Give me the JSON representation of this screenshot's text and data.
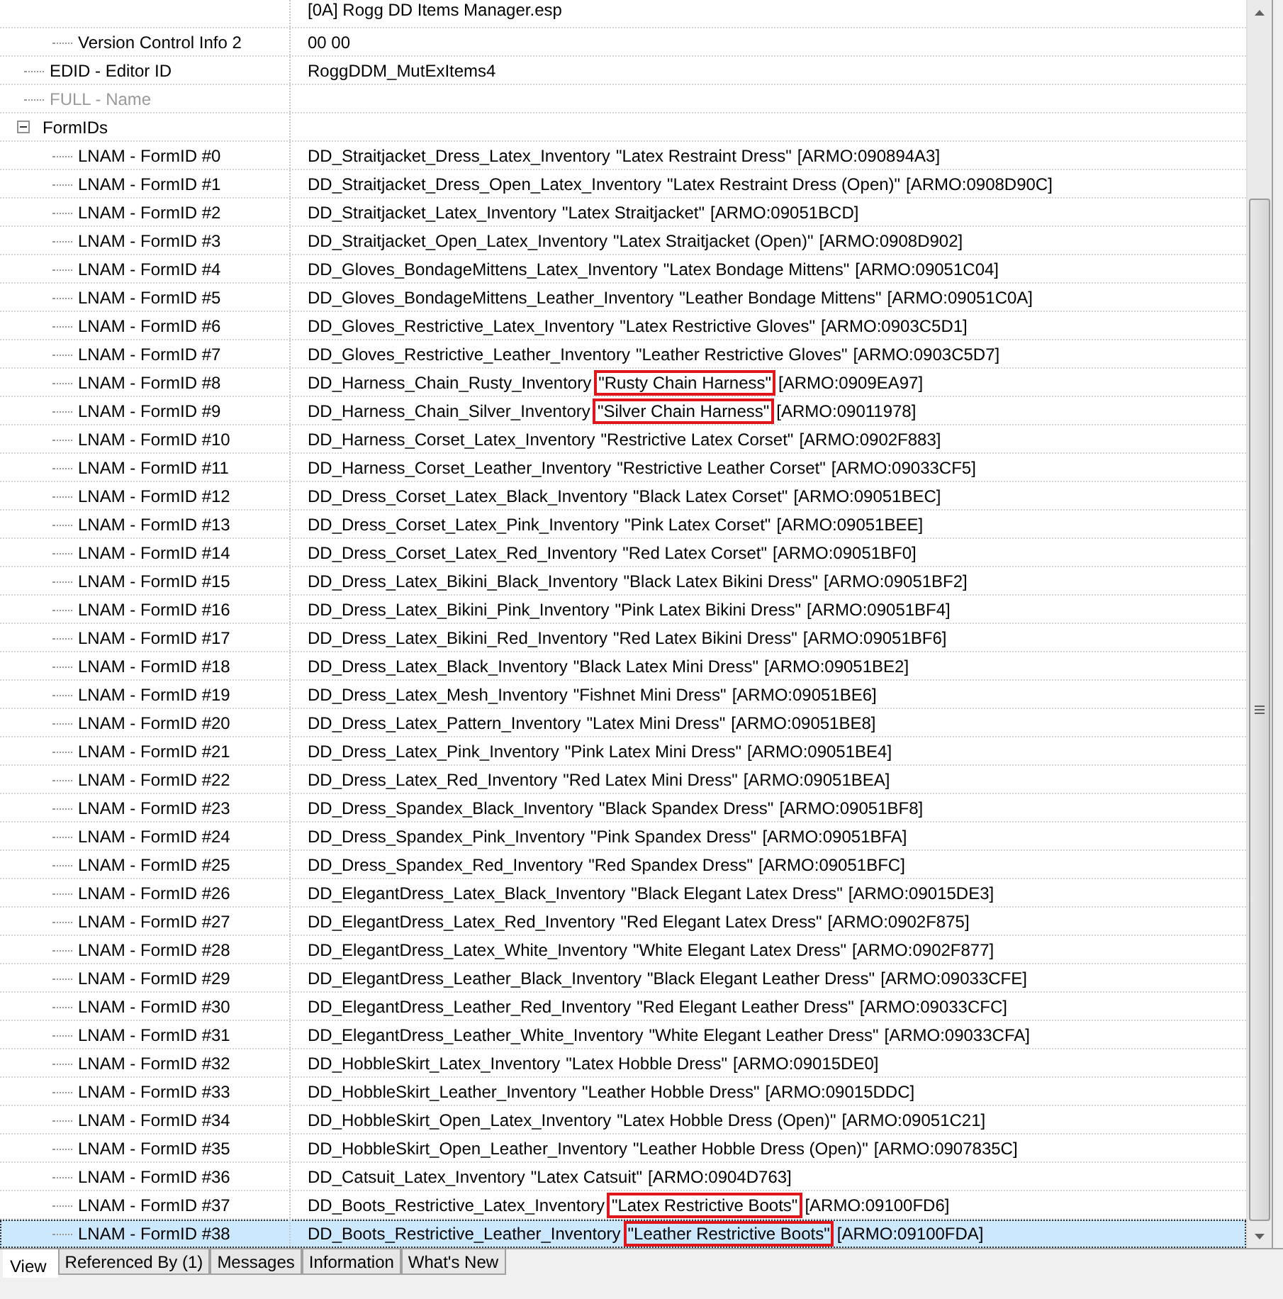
{
  "header": {
    "file": "[0A] Rogg DD Items Manager.esp"
  },
  "tree": [
    {
      "children": [
        {
          "kind": "field",
          "label": "Version Control Info 2",
          "value": "00 00",
          "disabled": false,
          "selected": false
        }
      ]
    },
    {
      "kind": "field",
      "label": "EDID - Editor ID",
      "value": "RoggDDM_MutExItems4",
      "disabled": false,
      "selected": false
    },
    {
      "kind": "field",
      "label": "FULL - Name",
      "disabled": true,
      "selected": false
    },
    {
      "kind": "group",
      "label": "FormIDs",
      "expanded": true,
      "selected": false,
      "children": [
        {
          "kind": "reference",
          "label": "LNAM - FormID #0",
          "edid": "DD_Straitjacket_Dress_Latex_Inventory",
          "full": "\"Latex Restraint Dress\"",
          "ref": "[ARMO:090894A3]",
          "highlighted": false,
          "selected": false
        },
        {
          "kind": "reference",
          "label": "LNAM - FormID #1",
          "edid": "DD_Straitjacket_Dress_Open_Latex_Inventory",
          "full": "\"Latex Restraint Dress (Open)\"",
          "ref": "[ARMO:0908D90C]",
          "highlighted": false,
          "selected": false
        },
        {
          "kind": "reference",
          "label": "LNAM - FormID #2",
          "edid": "DD_Straitjacket_Latex_Inventory",
          "full": "\"Latex Straitjacket\"",
          "ref": "[ARMO:09051BCD]",
          "highlighted": false,
          "selected": false
        },
        {
          "kind": "reference",
          "label": "LNAM - FormID #3",
          "edid": "DD_Straitjacket_Open_Latex_Inventory",
          "full": "\"Latex Straitjacket (Open)\"",
          "ref": "[ARMO:0908D902]",
          "highlighted": false,
          "selected": false
        },
        {
          "kind": "reference",
          "label": "LNAM - FormID #4",
          "edid": "DD_Gloves_BondageMittens_Latex_Inventory",
          "full": "\"Latex Bondage Mittens\"",
          "ref": "[ARMO:09051C04]",
          "highlighted": false,
          "selected": false
        },
        {
          "kind": "reference",
          "label": "LNAM - FormID #5",
          "edid": "DD_Gloves_BondageMittens_Leather_Inventory",
          "full": "\"Leather Bondage Mittens\"",
          "ref": "[ARMO:09051C0A]",
          "highlighted": false,
          "selected": false
        },
        {
          "kind": "reference",
          "label": "LNAM - FormID #6",
          "edid": "DD_Gloves_Restrictive_Latex_Inventory",
          "full": "\"Latex Restrictive Gloves\"",
          "ref": "[ARMO:0903C5D1]",
          "highlighted": false,
          "selected": false
        },
        {
          "kind": "reference",
          "label": "LNAM - FormID #7",
          "edid": "DD_Gloves_Restrictive_Leather_Inventory",
          "full": "\"Leather Restrictive Gloves\"",
          "ref": "[ARMO:0903C5D7]",
          "highlighted": false,
          "selected": false
        },
        {
          "kind": "reference",
          "label": "LNAM - FormID #8",
          "edid": "DD_Harness_Chain_Rusty_Inventory",
          "full": "\"Rusty Chain Harness\"",
          "ref": "[ARMO:0909EA97]",
          "highlighted": true,
          "selected": false
        },
        {
          "kind": "reference",
          "label": "LNAM - FormID #9",
          "edid": "DD_Harness_Chain_Silver_Inventory",
          "full": "\"Silver Chain Harness\"",
          "ref": "[ARMO:09011978]",
          "highlighted": true,
          "selected": false
        },
        {
          "kind": "reference",
          "label": "LNAM - FormID #10",
          "edid": "DD_Harness_Corset_Latex_Inventory",
          "full": "\"Restrictive Latex Corset\"",
          "ref": "[ARMO:0902F883]",
          "highlighted": false,
          "selected": false
        },
        {
          "kind": "reference",
          "label": "LNAM - FormID #11",
          "edid": "DD_Harness_Corset_Leather_Inventory",
          "full": "\"Restrictive Leather Corset\"",
          "ref": "[ARMO:09033CF5]",
          "highlighted": false,
          "selected": false
        },
        {
          "kind": "reference",
          "label": "LNAM - FormID #12",
          "edid": "DD_Dress_Corset_Latex_Black_Inventory",
          "full": "\"Black Latex Corset\"",
          "ref": "[ARMO:09051BEC]",
          "highlighted": false,
          "selected": false
        },
        {
          "kind": "reference",
          "label": "LNAM - FormID #13",
          "edid": "DD_Dress_Corset_Latex_Pink_Inventory",
          "full": "\"Pink Latex Corset\"",
          "ref": "[ARMO:09051BEE]",
          "highlighted": false,
          "selected": false
        },
        {
          "kind": "reference",
          "label": "LNAM - FormID #14",
          "edid": "DD_Dress_Corset_Latex_Red_Inventory",
          "full": "\"Red Latex Corset\"",
          "ref": "[ARMO:09051BF0]",
          "highlighted": false,
          "selected": false
        },
        {
          "kind": "reference",
          "label": "LNAM - FormID #15",
          "edid": "DD_Dress_Latex_Bikini_Black_Inventory",
          "full": "\"Black Latex Bikini Dress\"",
          "ref": "[ARMO:09051BF2]",
          "highlighted": false,
          "selected": false
        },
        {
          "kind": "reference",
          "label": "LNAM - FormID #16",
          "edid": "DD_Dress_Latex_Bikini_Pink_Inventory",
          "full": "\"Pink Latex Bikini Dress\"",
          "ref": "[ARMO:09051BF4]",
          "highlighted": false,
          "selected": false
        },
        {
          "kind": "reference",
          "label": "LNAM - FormID #17",
          "edid": "DD_Dress_Latex_Bikini_Red_Inventory",
          "full": "\"Red Latex Bikini Dress\"",
          "ref": "[ARMO:09051BF6]",
          "highlighted": false,
          "selected": false
        },
        {
          "kind": "reference",
          "label": "LNAM - FormID #18",
          "edid": "DD_Dress_Latex_Black_Inventory",
          "full": "\"Black Latex Mini Dress\"",
          "ref": "[ARMO:09051BE2]",
          "highlighted": false,
          "selected": false
        },
        {
          "kind": "reference",
          "label": "LNAM - FormID #19",
          "edid": "DD_Dress_Latex_Mesh_Inventory",
          "full": "\"Fishnet Mini Dress\"",
          "ref": "[ARMO:09051BE6]",
          "highlighted": false,
          "selected": false
        },
        {
          "kind": "reference",
          "label": "LNAM - FormID #20",
          "edid": "DD_Dress_Latex_Pattern_Inventory",
          "full": "\"Latex Mini Dress\"",
          "ref": "[ARMO:09051BE8]",
          "highlighted": false,
          "selected": false
        },
        {
          "kind": "reference",
          "label": "LNAM - FormID #21",
          "edid": "DD_Dress_Latex_Pink_Inventory",
          "full": "\"Pink Latex Mini Dress\"",
          "ref": "[ARMO:09051BE4]",
          "highlighted": false,
          "selected": false
        },
        {
          "kind": "reference",
          "label": "LNAM - FormID #22",
          "edid": "DD_Dress_Latex_Red_Inventory",
          "full": "\"Red Latex Mini Dress\"",
          "ref": "[ARMO:09051BEA]",
          "highlighted": false,
          "selected": false
        },
        {
          "kind": "reference",
          "label": "LNAM - FormID #23",
          "edid": "DD_Dress_Spandex_Black_Inventory",
          "full": "\"Black Spandex Dress\"",
          "ref": "[ARMO:09051BF8]",
          "highlighted": false,
          "selected": false
        },
        {
          "kind": "reference",
          "label": "LNAM - FormID #24",
          "edid": "DD_Dress_Spandex_Pink_Inventory",
          "full": "\"Pink Spandex Dress\"",
          "ref": "[ARMO:09051BFA]",
          "highlighted": false,
          "selected": false
        },
        {
          "kind": "reference",
          "label": "LNAM - FormID #25",
          "edid": "DD_Dress_Spandex_Red_Inventory",
          "full": "\"Red Spandex Dress\"",
          "ref": "[ARMO:09051BFC]",
          "highlighted": false,
          "selected": false
        },
        {
          "kind": "reference",
          "label": "LNAM - FormID #26",
          "edid": "DD_ElegantDress_Latex_Black_Inventory",
          "full": "\"Black Elegant Latex Dress\"",
          "ref": "[ARMO:09015DE3]",
          "highlighted": false,
          "selected": false
        },
        {
          "kind": "reference",
          "label": "LNAM - FormID #27",
          "edid": "DD_ElegantDress_Latex_Red_Inventory",
          "full": "\"Red Elegant Latex Dress\"",
          "ref": "[ARMO:0902F875]",
          "highlighted": false,
          "selected": false
        },
        {
          "kind": "reference",
          "label": "LNAM - FormID #28",
          "edid": "DD_ElegantDress_Latex_White_Inventory",
          "full": "\"White Elegant Latex Dress\"",
          "ref": "[ARMO:0902F877]",
          "highlighted": false,
          "selected": false
        },
        {
          "kind": "reference",
          "label": "LNAM - FormID #29",
          "edid": "DD_ElegantDress_Leather_Black_Inventory",
          "full": "\"Black Elegant Leather Dress\"",
          "ref": "[ARMO:09033CFE]",
          "highlighted": false,
          "selected": false
        },
        {
          "kind": "reference",
          "label": "LNAM - FormID #30",
          "edid": "DD_ElegantDress_Leather_Red_Inventory",
          "full": "\"Red Elegant Leather Dress\"",
          "ref": "[ARMO:09033CFC]",
          "highlighted": false,
          "selected": false
        },
        {
          "kind": "reference",
          "label": "LNAM - FormID #31",
          "edid": "DD_ElegantDress_Leather_White_Inventory",
          "full": "\"White Elegant Leather Dress\"",
          "ref": "[ARMO:09033CFA]",
          "highlighted": false,
          "selected": false
        },
        {
          "kind": "reference",
          "label": "LNAM - FormID #32",
          "edid": "DD_HobbleSkirt_Latex_Inventory",
          "full": "\"Latex Hobble Dress\"",
          "ref": "[ARMO:09015DE0]",
          "highlighted": false,
          "selected": false
        },
        {
          "kind": "reference",
          "label": "LNAM - FormID #33",
          "edid": "DD_HobbleSkirt_Leather_Inventory",
          "full": "\"Leather Hobble Dress\"",
          "ref": "[ARMO:09015DDC]",
          "highlighted": false,
          "selected": false
        },
        {
          "kind": "reference",
          "label": "LNAM - FormID #34",
          "edid": "DD_HobbleSkirt_Open_Latex_Inventory",
          "full": "\"Latex Hobble Dress (Open)\"",
          "ref": "[ARMO:09051C21]",
          "highlighted": false,
          "selected": false
        },
        {
          "kind": "reference",
          "label": "LNAM - FormID #35",
          "edid": "DD_HobbleSkirt_Open_Leather_Inventory",
          "full": "\"Leather Hobble Dress (Open)\"",
          "ref": "[ARMO:0907835C]",
          "highlighted": false,
          "selected": false
        },
        {
          "kind": "reference",
          "label": "LNAM - FormID #36",
          "edid": "DD_Catsuit_Latex_Inventory",
          "full": "\"Latex Catsuit\"",
          "ref": "[ARMO:0904D763]",
          "highlighted": false,
          "selected": false
        },
        {
          "kind": "reference",
          "label": "LNAM - FormID #37",
          "edid": "DD_Boots_Restrictive_Latex_Inventory",
          "full": "\"Latex Restrictive Boots\"",
          "ref": "[ARMO:09100FD6]",
          "highlighted": true,
          "selected": false
        },
        {
          "kind": "reference",
          "label": "LNAM - FormID #38",
          "edid": "DD_Boots_Restrictive_Leather_Inventory",
          "full": "\"Leather Restrictive Boots\"",
          "ref": "[ARMO:09100FDA]",
          "highlighted": true,
          "selected": true
        }
      ]
    }
  ],
  "tabs": [
    {
      "label": "View",
      "selected": true
    },
    {
      "label": "Referenced By (1)",
      "selected": false
    },
    {
      "label": "Messages",
      "selected": false
    },
    {
      "label": "Information",
      "selected": false
    },
    {
      "label": "What's New",
      "selected": false
    }
  ]
}
